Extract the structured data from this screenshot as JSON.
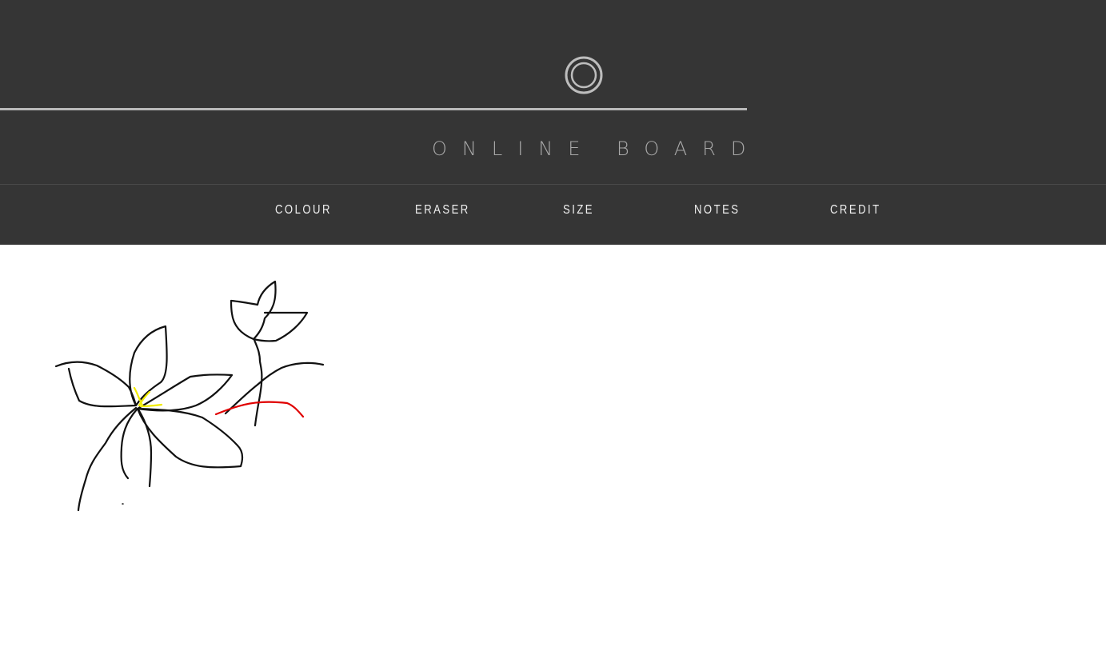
{
  "app": {
    "title": "ONLINE BOARD",
    "logo": "ring-logo-icon"
  },
  "nav": {
    "items": [
      {
        "label": "COLOUR",
        "name": "nav-colour"
      },
      {
        "label": "ERASER",
        "name": "nav-eraser"
      },
      {
        "label": "SIZE",
        "name": "nav-size"
      },
      {
        "label": "NOTES",
        "name": "nav-notes"
      },
      {
        "label": "CREDIT",
        "name": "nav-credit"
      }
    ]
  },
  "colors": {
    "header": "#353535",
    "canvas": "#ffffff",
    "stroke_black": "#111111",
    "stroke_yellow": "#f2ec00",
    "stroke_red": "#e00000"
  },
  "drawing": {
    "visible_strokes": [
      "black",
      "yellow",
      "red"
    ]
  }
}
